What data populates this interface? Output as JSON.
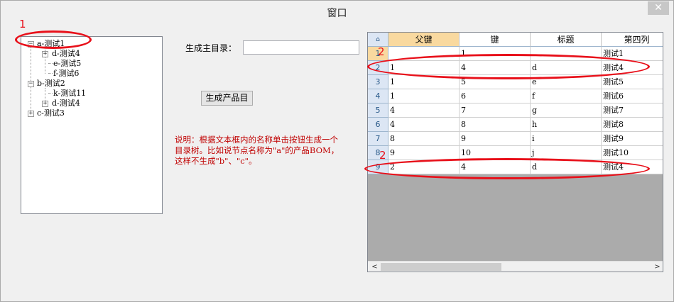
{
  "window": {
    "title": "窗口",
    "close_glyph": "✕"
  },
  "tree": {
    "nodes": [
      {
        "label": "a-测试1",
        "expander": "−"
      },
      {
        "label": "d-测试4",
        "expander": "+"
      },
      {
        "label": "e-测试5",
        "expander": ""
      },
      {
        "label": "f-测试6",
        "expander": ""
      },
      {
        "label": "b-测试2",
        "expander": "−"
      },
      {
        "label": "k-测试11",
        "expander": ""
      },
      {
        "label": "d-测试4",
        "expander": "+"
      },
      {
        "label": "c-测试3",
        "expander": "+"
      }
    ]
  },
  "form": {
    "main_dir_label": "生成主目录：",
    "main_dir_value": "",
    "generate_button": "生成产品目"
  },
  "description": "说明：根据文本框内的名称单击按钮生成一个\n目录树。比如说节点名称为\"a\"的产品BOM，\n这样不生成\"b\"、\"c\"。",
  "grid": {
    "corner_glyph": "⌂",
    "columns": [
      "父键",
      "键",
      "标题",
      "第四列"
    ],
    "rows": [
      {
        "num": "1",
        "cells": [
          "",
          "1",
          "",
          "测试1"
        ]
      },
      {
        "num": "2",
        "cells": [
          "1",
          "4",
          "d",
          "测试4"
        ]
      },
      {
        "num": "3",
        "cells": [
          "1",
          "5",
          "e",
          "测试5"
        ]
      },
      {
        "num": "4",
        "cells": [
          "1",
          "6",
          "f",
          "测试6"
        ]
      },
      {
        "num": "5",
        "cells": [
          "4",
          "7",
          "g",
          "测试7"
        ]
      },
      {
        "num": "6",
        "cells": [
          "4",
          "8",
          "h",
          "测试8"
        ]
      },
      {
        "num": "7",
        "cells": [
          "8",
          "9",
          "i",
          "测试9"
        ]
      },
      {
        "num": "8",
        "cells": [
          "9",
          "10",
          "j",
          "测试10"
        ]
      },
      {
        "num": "9",
        "cells": [
          "2",
          "4",
          "d",
          "测试4"
        ]
      }
    ],
    "scroll_left": "<",
    "scroll_right": ">"
  },
  "annotations": {
    "label_1": "1",
    "label_2a": "2",
    "label_2b": "2",
    "color": "#e8101a"
  }
}
